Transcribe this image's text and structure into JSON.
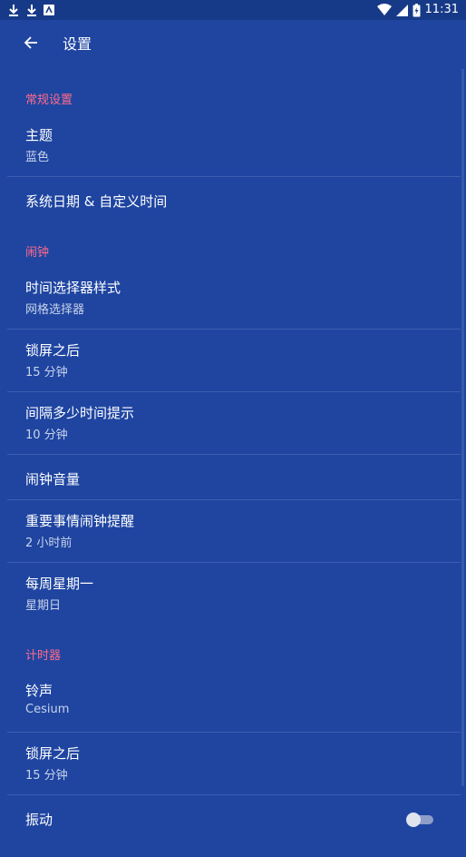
{
  "status_bar": {
    "time": "11:31",
    "left_icons": [
      "download-icon",
      "download-icon",
      "notification-icon"
    ],
    "right_icons": [
      "wifi-icon",
      "signal-icon",
      "battery-icon"
    ]
  },
  "app_bar": {
    "title": "设置",
    "back_icon": "arrow-left-icon"
  },
  "sections": {
    "general": {
      "header": "常规设置",
      "items": [
        {
          "title": "主题",
          "summary": "蓝色"
        },
        {
          "title": "系统日期 & 自定义时间"
        }
      ]
    },
    "alarm": {
      "header": "闹钟",
      "items": [
        {
          "title": "时间选择器样式",
          "summary": "网格选择器"
        },
        {
          "title": "锁屏之后",
          "summary": "15 分钟"
        },
        {
          "title": "间隔多少时间提示",
          "summary": "10 分钟"
        },
        {
          "title": "闹钟音量"
        },
        {
          "title": "重要事情闹钟提醒",
          "summary": "2 小时前"
        },
        {
          "title": "每周星期一",
          "summary": "星期日"
        }
      ]
    },
    "timer": {
      "header": "计时器",
      "items": [
        {
          "title": "铃声",
          "summary": "Cesium"
        },
        {
          "title": "锁屏之后",
          "summary": "15 分钟"
        },
        {
          "title": "振动",
          "toggle_on": false
        }
      ]
    }
  },
  "colors": {
    "background": "#1f45a1",
    "status_bar": "#173a88",
    "section_header": "#ff6b8a",
    "summary_text": "#c9d3ea",
    "divider": "#3d5eae"
  }
}
